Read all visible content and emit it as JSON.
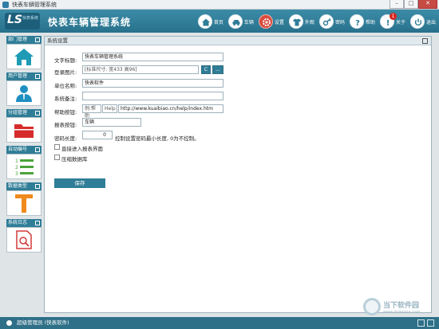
{
  "window": {
    "title": "快表车辆管理系统"
  },
  "header": {
    "logo_mark": "LS",
    "logo_small": "快表系统",
    "app_title": "快表车辆管理系统",
    "nav": [
      {
        "label": "首页",
        "icon": "home-icon"
      },
      {
        "label": "车辆",
        "icon": "car-icon"
      },
      {
        "label": "设置",
        "icon": "gear-icon"
      },
      {
        "label": "外观",
        "icon": "shirt-icon"
      },
      {
        "label": "密码",
        "icon": "key-icon"
      },
      {
        "label": "帮助",
        "icon": "help-icon"
      },
      {
        "label": "关于",
        "icon": "info-icon",
        "badge": "1"
      },
      {
        "label": "退出",
        "icon": "power-icon"
      }
    ]
  },
  "sidebar": {
    "sections": [
      {
        "title": "部门管理",
        "icon": "house-icon"
      },
      {
        "title": "用户管理",
        "icon": "user-icon"
      },
      {
        "title": "分组管理",
        "icon": "folder-icon"
      },
      {
        "title": "自动编号",
        "icon": "numbered-list-icon"
      },
      {
        "title": "数据类型",
        "icon": "type-icon"
      },
      {
        "title": "系统日志",
        "icon": "log-search-icon"
      }
    ]
  },
  "panel": {
    "title": "系统设置",
    "form": {
      "text_title_label": "文字标题:",
      "text_title_value": "快表车辆管理系统",
      "login_image_label": "登录图片:",
      "login_image_value": "[标准尺寸: 宽433 高96]",
      "login_image_clear": "C",
      "login_image_browse": "...",
      "org_name_label": "单位名称:",
      "org_name_value": "快表软件",
      "remark_label": "系统备注:",
      "remark_value": "",
      "help_label": "帮助按钮:",
      "help_text_value": "例:帮助",
      "help_alt_value": "Help",
      "help_url_value": "http://www.kuaibiao.cn/help/index.htm",
      "report_btn_label": "报表按钮:",
      "report_btn_value": "车辆",
      "pwd_len_label": "密码长度:",
      "pwd_len_value": "0",
      "pwd_len_hint": "控制设置密码最小长度, 0为不控制。",
      "direct_report_label": "直接进入报表界面",
      "compress_db_label": "压缩数据库",
      "save_label": "保存"
    }
  },
  "watermark": {
    "line1": "当下软件园",
    "line2": "www.downxia.com"
  },
  "status": {
    "user_text": "超级管理员 (快表软件)"
  }
}
